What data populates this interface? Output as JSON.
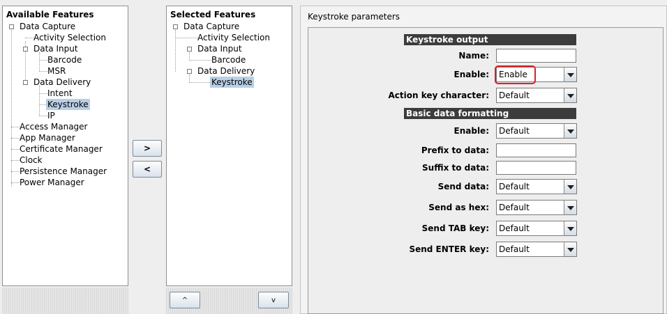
{
  "available": {
    "title": "Available Features",
    "items": {
      "data_capture": "Data Capture",
      "activity_selection": "Activity Selection",
      "data_input": "Data Input",
      "barcode": "Barcode",
      "msr": "MSR",
      "data_delivery": "Data Delivery",
      "intent": "Intent",
      "keystroke": "Keystroke",
      "ip": "IP",
      "access_manager": "Access Manager",
      "app_manager": "App Manager",
      "certificate_manager": "Certificate Manager",
      "clock": "Clock",
      "persistence_manager": "Persistence Manager",
      "power_manager": "Power Manager"
    }
  },
  "selected": {
    "title": "Selected Features",
    "items": {
      "data_capture": "Data Capture",
      "activity_selection": "Activity Selection",
      "data_input": "Data Input",
      "barcode": "Barcode",
      "data_delivery": "Data Delivery",
      "keystroke": "Keystroke"
    }
  },
  "transfer": {
    "add": ">",
    "remove": "<"
  },
  "order": {
    "up": "^",
    "down": "v"
  },
  "params": {
    "title": "Keystroke parameters",
    "sections": {
      "output": "Keystroke output",
      "formatting": "Basic data formatting"
    },
    "fields": {
      "name": {
        "label": "Name:",
        "value": ""
      },
      "enable": {
        "label": "Enable:",
        "value": "Enable"
      },
      "action_key": {
        "label": "Action key character:",
        "value": "Default"
      },
      "fmt_enable": {
        "label": "Enable:",
        "value": "Default"
      },
      "prefix": {
        "label": "Prefix to data:",
        "value": ""
      },
      "suffix": {
        "label": "Suffix to data:",
        "value": ""
      },
      "send_data": {
        "label": "Send data:",
        "value": "Default"
      },
      "send_hex": {
        "label": "Send as hex:",
        "value": "Default"
      },
      "send_tab": {
        "label": "Send TAB key:",
        "value": "Default"
      },
      "send_enter": {
        "label": "Send ENTER key:",
        "value": "Default"
      }
    }
  },
  "colors": {
    "selection": "#b8cfe5",
    "section_header": "#3c3c3c",
    "highlight": "#e01b24"
  }
}
